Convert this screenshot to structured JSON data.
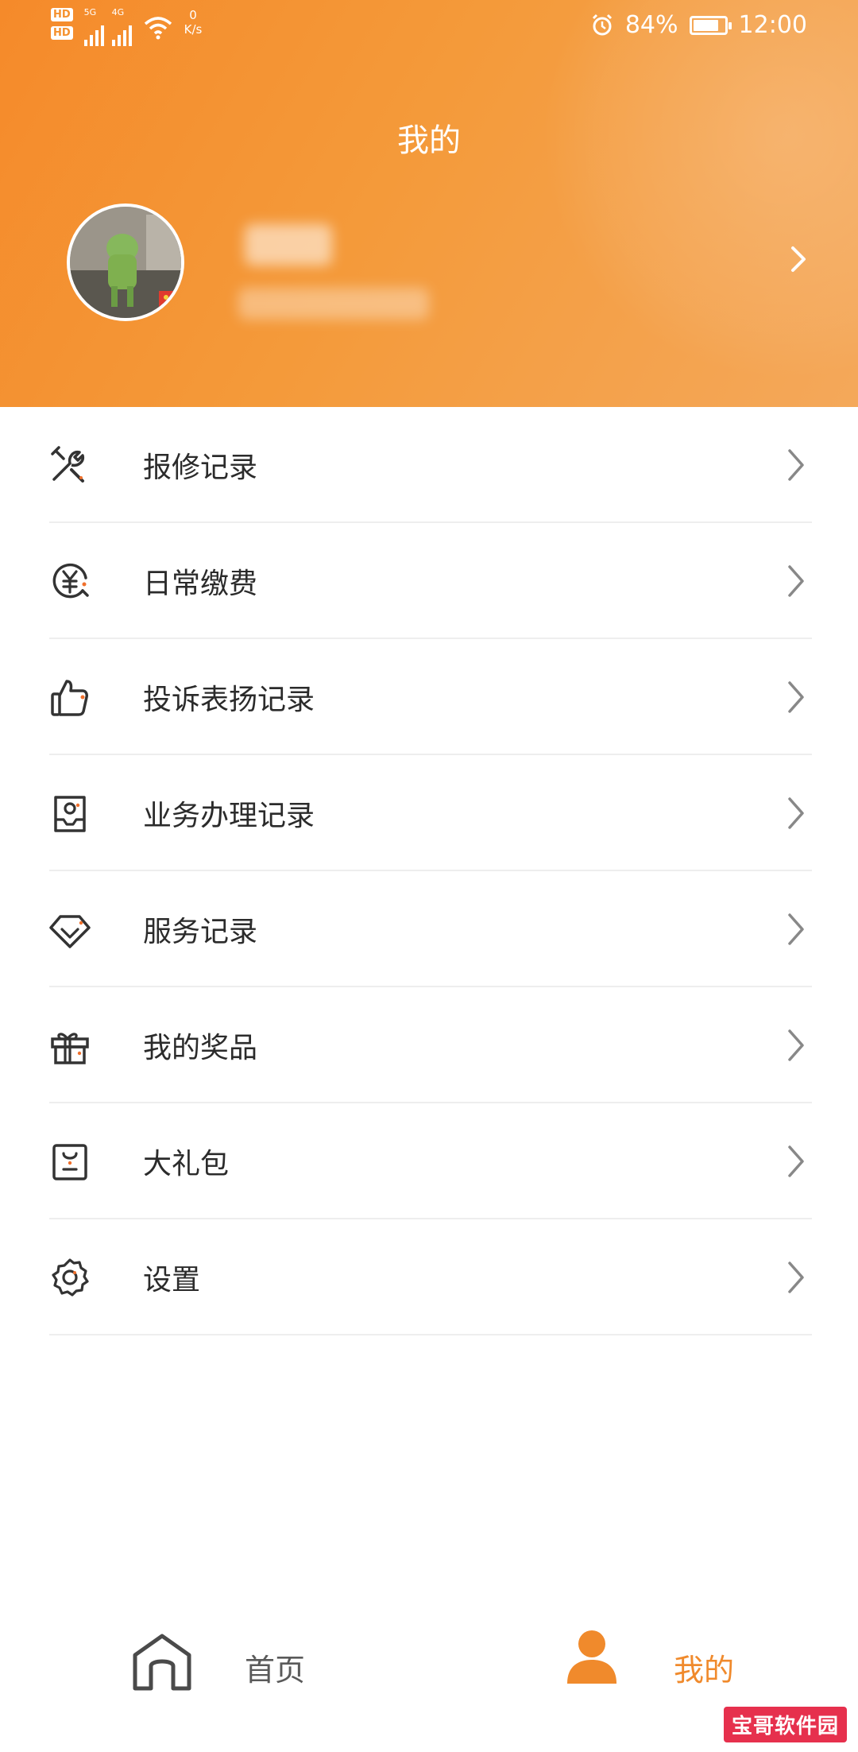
{
  "status_bar": {
    "hd_badges": [
      "HD",
      "HD"
    ],
    "network_labels": [
      "5G",
      "4G"
    ],
    "speed_value": "0",
    "speed_unit": "K/s",
    "battery": "84%",
    "battery_level": 0.84,
    "time": "12:00",
    "icons": [
      "hd-icon",
      "signal-icon",
      "wifi-icon",
      "alarm-icon",
      "battery-icon"
    ]
  },
  "header": {
    "title": "我的",
    "profile": {
      "name": "",
      "subtitle": ""
    },
    "colors": {
      "gradient_start": "#f58a2a",
      "gradient_end": "#f4a85a"
    }
  },
  "menu": {
    "items": [
      {
        "label": "报修记录",
        "icon": "repair-tools-icon"
      },
      {
        "label": "日常缴费",
        "icon": "yuan-payment-icon"
      },
      {
        "label": "投诉表扬记录",
        "icon": "thumbs-up-icon"
      },
      {
        "label": "业务办理记录",
        "icon": "business-record-icon"
      },
      {
        "label": "服务记录",
        "icon": "service-diamond-icon"
      },
      {
        "label": "我的奖品",
        "icon": "gift-icon"
      },
      {
        "label": "大礼包",
        "icon": "gift-package-icon"
      },
      {
        "label": "设置",
        "icon": "gear-icon"
      }
    ]
  },
  "bottom_nav": {
    "tabs": [
      {
        "label": "首页",
        "icon": "home-icon",
        "active": false
      },
      {
        "label": "我的",
        "icon": "user-icon",
        "active": true
      }
    ],
    "accent_color": "#f08a2c"
  },
  "watermark": {
    "text": "宝哥软件园"
  }
}
